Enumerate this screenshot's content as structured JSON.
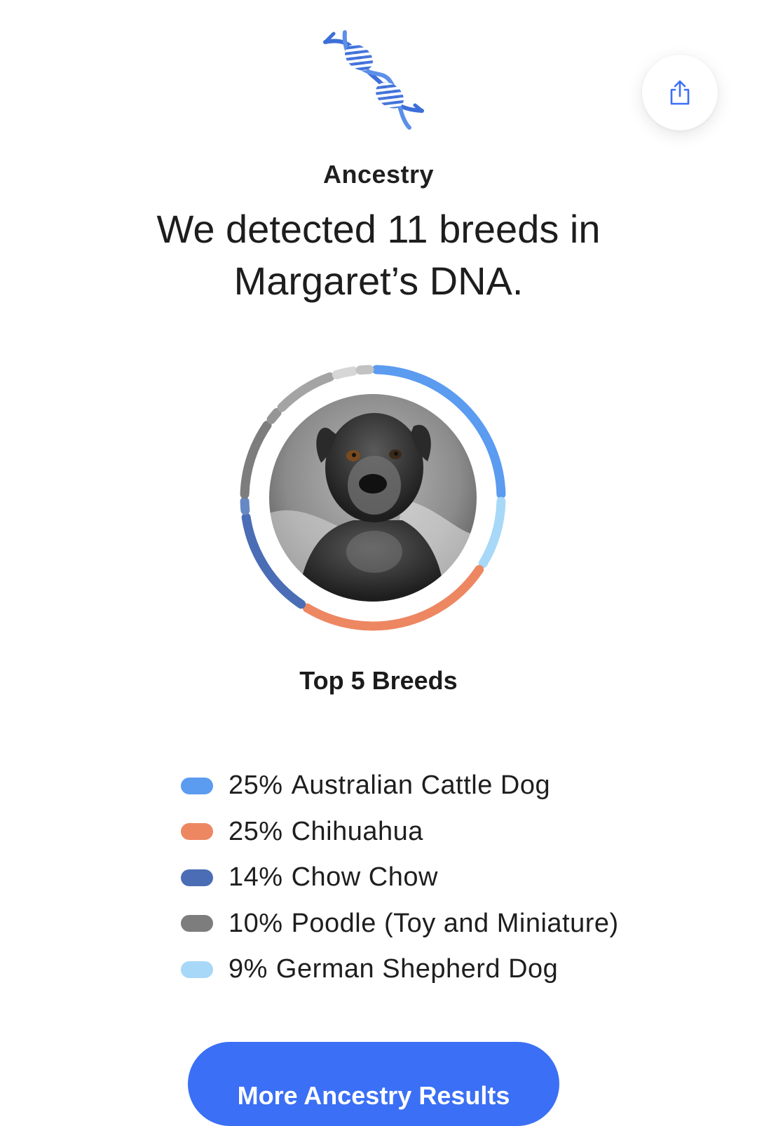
{
  "header": {
    "logo_icon": "dna-helix-icon",
    "share_icon": "share-icon",
    "eyebrow": "Ancestry",
    "headline": "We detected 11 breeds in Margaret’s DNA."
  },
  "colors": {
    "australian_cattle_dog": "#5b9bf0",
    "chihuahua": "#ed8762",
    "chow_chow": "#4a6db5",
    "poodle": "#7d7d7d",
    "german_shepherd_dog": "#a7d8f8",
    "other_gray": "#a4a4a4",
    "other_light": "#d6d6d6",
    "cta": "#3b6ff5"
  },
  "breed_ring": {
    "photo_subject": "dog-photo",
    "segments": [
      {
        "breed": "Australian Cattle Dog",
        "percent": 25,
        "color": "#5b9bf0"
      },
      {
        "breed": "German Shepherd Dog",
        "percent": 9,
        "color": "#a7d8f8"
      },
      {
        "breed": "Chihuahua",
        "percent": 25,
        "color": "#ed8762"
      },
      {
        "breed": "Chow Chow",
        "percent": 14,
        "color": "#4a6db5"
      },
      {
        "breed": "other",
        "percent": 2,
        "color": "#6688c4"
      },
      {
        "breed": "Poodle (Toy and Miniature)",
        "percent": 10,
        "color": "#7d7d7d"
      },
      {
        "breed": "other",
        "percent": 2,
        "color": "#959595"
      },
      {
        "breed": "other",
        "percent": 8,
        "color": "#a4a4a4"
      },
      {
        "breed": "other",
        "percent": 3,
        "color": "#d6d6d6"
      },
      {
        "breed": "other",
        "percent": 2,
        "color": "#c2c2c2"
      }
    ]
  },
  "top_breeds": {
    "title": "Top 5 Breeds",
    "items": [
      {
        "percent": "25%",
        "name": "Australian Cattle Dog",
        "color": "#5b9bf0"
      },
      {
        "percent": "25%",
        "name": "Chihuahua",
        "color": "#ed8762"
      },
      {
        "percent": "14%",
        "name": "Chow Chow",
        "color": "#4a6db5"
      },
      {
        "percent": "10%",
        "name": "Poodle (Toy and Miniature)",
        "color": "#7d7d7d"
      },
      {
        "percent": "9%",
        "name": "German Shepherd Dog",
        "color": "#a7d8f8"
      }
    ]
  },
  "cta": {
    "label": "More Ancestry Results"
  }
}
